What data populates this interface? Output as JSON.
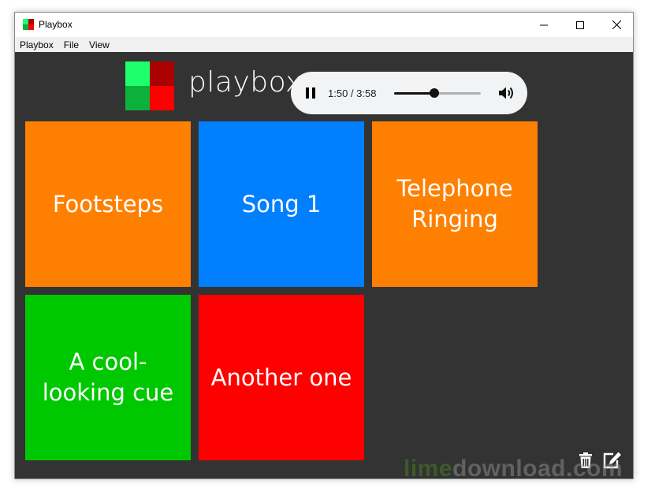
{
  "window": {
    "title": "Playbox",
    "menu": [
      "Playbox",
      "File",
      "View"
    ]
  },
  "app": {
    "brand": "playbox",
    "logo_colors": [
      "#1dff6b",
      "#aa0000",
      "#0bb13b",
      "#ff0000"
    ]
  },
  "player": {
    "time": "1:50 / 3:58",
    "progress": 0.46,
    "state": "playing",
    "icons": [
      "pause-icon",
      "volume-icon"
    ]
  },
  "cues": [
    {
      "label": "Footsteps",
      "color": "#ff7f00"
    },
    {
      "label": "Song 1",
      "color": "#007fff"
    },
    {
      "label": "Telephone Ringing",
      "color": "#ff7f00"
    },
    {
      "label": "A cool-looking cue",
      "color": "#00c800"
    },
    {
      "label": "Another one",
      "color": "#ff0000"
    }
  ],
  "toolbar": {
    "icons": [
      "trash-icon",
      "edit-icon"
    ]
  },
  "watermark": {
    "part1": "lime",
    "part2": "download.com"
  },
  "colors": {
    "background": "#333333",
    "menubar": "#f0f0f0",
    "player": "#f1f3f4"
  }
}
